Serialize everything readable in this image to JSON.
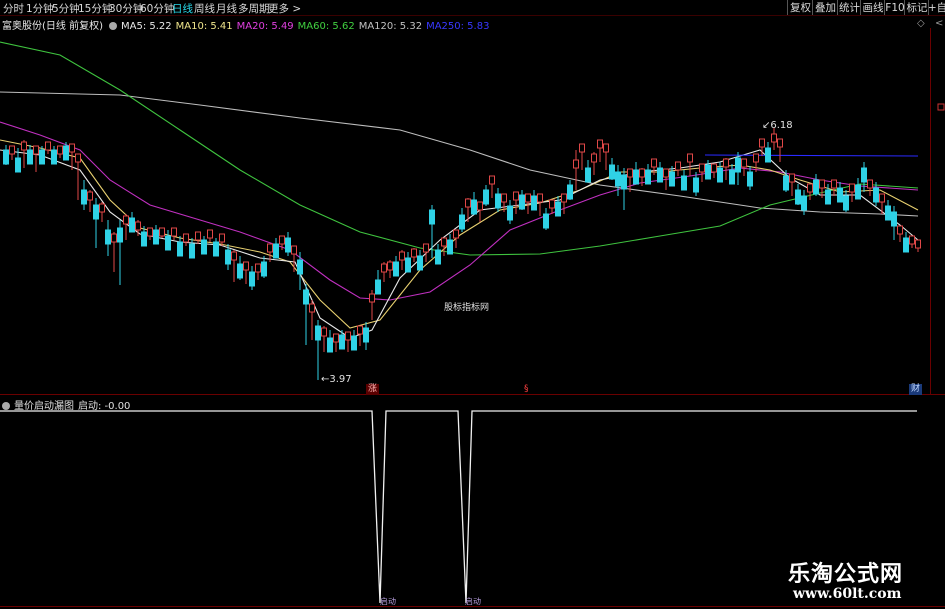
{
  "toolbar": {
    "periods": [
      "分时",
      "1分钟",
      "5分钟",
      "15分钟",
      "30分钟",
      "60分钟",
      "日线",
      "周线",
      "月线",
      "多周期",
      "更多"
    ],
    "active_period": "日线",
    "right_buttons": [
      "复权",
      "叠加",
      "统计",
      "画线",
      "F10",
      "标记",
      "+自"
    ]
  },
  "main_chart": {
    "stock_title": "富奥股份(日线 前复权)",
    "ma_labels": [
      {
        "text": "MA5: 5.22",
        "color": "#e8e8e8"
      },
      {
        "text": "MA10: 5.41",
        "color": "#f0e68c"
      },
      {
        "text": "MA20: 5.49",
        "color": "#e040e0"
      },
      {
        "text": "MA60: 5.62",
        "color": "#40d040"
      },
      {
        "text": "MA120: 5.32",
        "color": "#c0c0c0"
      },
      {
        "text": "MA250: 5.83",
        "color": "#4040ff"
      }
    ],
    "high_label": "6.18",
    "low_label": "3.97",
    "center_label": "股标指标网",
    "marker_left": "涨",
    "marker_mid": "§",
    "marker_right": "财"
  },
  "indicator": {
    "title": "量价启动漏图",
    "value_label": "启动: -0.00",
    "spike_label_1": "启动",
    "spike_label_2": "启动"
  },
  "watermark": {
    "title": "乐淘公式网",
    "url": "www.60lt.com"
  },
  "icons": [
    "settings-circle-icon",
    "chevron-right-icon",
    "diamond-icon",
    "chevron-left-icon"
  ]
}
